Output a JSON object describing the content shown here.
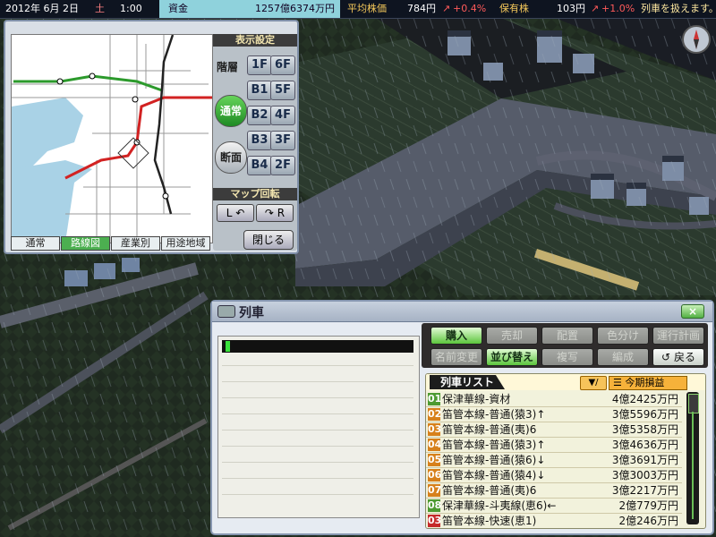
{
  "status_bar": {
    "date": "2012年 6月 2日",
    "weekday": "土",
    "time": "1:00",
    "funds_label": "資金",
    "funds_value": "1257億6374万円",
    "avg_stock_label": "平均株価",
    "avg_stock_value": "784円",
    "avg_stock_change": "+0.4%",
    "holdings_label": "保有株",
    "holdings_value": "103円",
    "holdings_change": "+1.0%",
    "message": "列車を扱えます。"
  },
  "map_panel": {
    "display_settings_label": "表示設定",
    "floor_label": "階層",
    "floors_left": [
      "1F",
      "B1",
      "B2",
      "B3",
      "B4"
    ],
    "floors_right": [
      "6F",
      "5F",
      "4F",
      "3F",
      "2F"
    ],
    "normal_label": "通常",
    "section_label": "断面",
    "rotate_label": "マップ回転",
    "rotate_left": "L",
    "rotate_right": "R",
    "tabs": [
      "通常",
      "路線図",
      "産業別",
      "用途地域"
    ],
    "active_tab": "路線図",
    "close_label": "閉じる"
  },
  "train_window": {
    "title": "列車",
    "close": "×",
    "buttons_row1": [
      {
        "label": "購入",
        "state": "active"
      },
      {
        "label": "売却",
        "state": "disabled"
      },
      {
        "label": "配置",
        "state": "disabled"
      },
      {
        "label": "色分け",
        "state": "disabled"
      },
      {
        "label": "運行計画",
        "state": "disabled"
      }
    ],
    "buttons_row2": [
      {
        "label": "名前変更",
        "state": "disabled"
      },
      {
        "label": "並び替え",
        "state": "active"
      },
      {
        "label": "複写",
        "state": "disabled"
      },
      {
        "label": "編成",
        "state": "disabled"
      },
      {
        "label": "戻る",
        "state": "normal"
      }
    ],
    "list_title": "列車リスト",
    "sort_glyph": "▼/",
    "column_header": "今期損益",
    "trains": [
      {
        "no": "01",
        "name": "保津華線-資材",
        "profit": "4億2425万円",
        "color": "#4c9a31"
      },
      {
        "no": "02",
        "name": "笛管本線-普通(猿3)↑",
        "profit": "3億5596万円",
        "color": "#d7801b"
      },
      {
        "no": "03",
        "name": "笛管本線-普通(夷)6",
        "profit": "3億5358万円",
        "color": "#d7801b"
      },
      {
        "no": "04",
        "name": "笛管本線-普通(猿3)↑",
        "profit": "3億4636万円",
        "color": "#d7801b"
      },
      {
        "no": "05",
        "name": "笛管本線-普通(猿6)↓",
        "profit": "3億3691万円",
        "color": "#d7801b"
      },
      {
        "no": "06",
        "name": "笛管本線-普通(猿4)↓",
        "profit": "3億3003万円",
        "color": "#d7801b"
      },
      {
        "no": "07",
        "name": "笛管本線-普通(夷)6",
        "profit": "3億2217万円",
        "color": "#d7801b"
      },
      {
        "no": "08",
        "name": "保津華線-斗夷線(恵6)←",
        "profit": "2億779万円",
        "color": "#4c9a31"
      },
      {
        "no": "03",
        "name": "笛管本線-快速(恵1)",
        "profit": "2億246万円",
        "color": "#c52a2a"
      }
    ]
  },
  "colors": {
    "accent_green": "#3dbf38",
    "funds_bg": "#8fd2dc",
    "rail_red": "#d22222",
    "rail_green": "#2c9a2c"
  }
}
